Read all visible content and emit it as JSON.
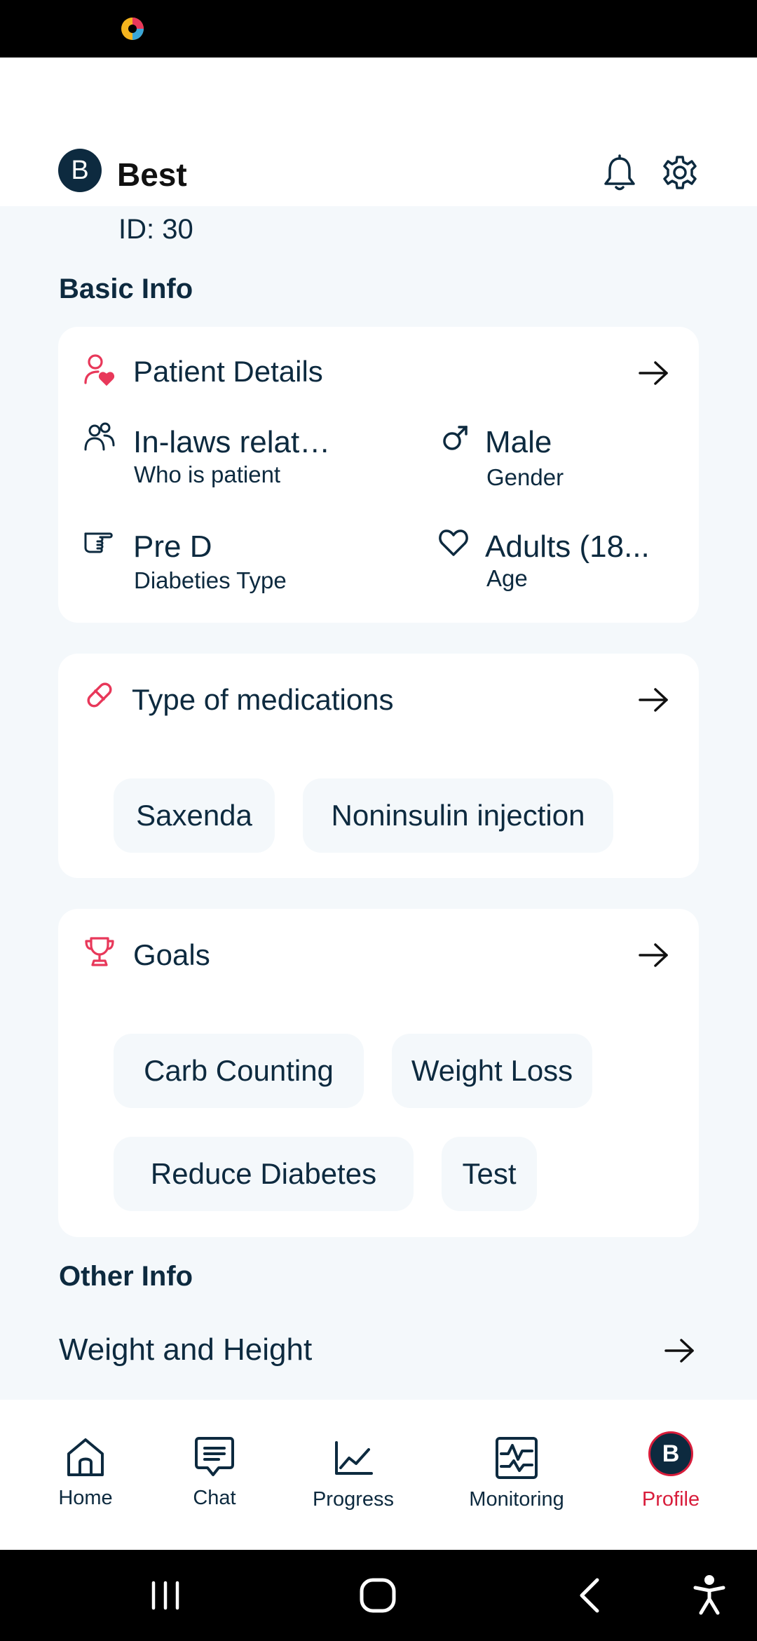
{
  "header": {
    "avatar_letter": "B",
    "user_name": "Best",
    "user_id": "ID: 30"
  },
  "sections": {
    "basic_info": "Basic Info",
    "other_info": "Other Info"
  },
  "patient_details": {
    "title": "Patient Details",
    "fields": [
      {
        "value": "In-laws relatives (d...",
        "label": "Who is patient",
        "icon": "people-icon"
      },
      {
        "value": "Male",
        "label": "Gender",
        "icon": "male-icon"
      },
      {
        "value": "Pre D",
        "label": "Diabeties Type",
        "icon": "pointing-hand-icon"
      },
      {
        "value": "Adults (18...",
        "label": "Age",
        "icon": "heart-icon"
      }
    ]
  },
  "medications": {
    "title": "Type of medications",
    "chips": [
      "Saxenda",
      "Noninsulin injection"
    ]
  },
  "goals": {
    "title": "Goals",
    "chips": [
      "Carb Counting",
      "Weight Loss",
      "Reduce Diabetes",
      "Test"
    ]
  },
  "other_info": {
    "rows": [
      "Weight and Height"
    ]
  },
  "bottom_nav": {
    "items": [
      {
        "label": "Home",
        "icon": "home-icon"
      },
      {
        "label": "Chat",
        "icon": "chat-icon"
      },
      {
        "label": "Progress",
        "icon": "progress-chart-icon"
      },
      {
        "label": "Monitoring",
        "icon": "monitoring-icon"
      },
      {
        "label": "Profile",
        "icon": "profile-avatar"
      }
    ],
    "profile_avatar_letter": "B",
    "active_color": "#d81d3b"
  },
  "colors": {
    "accent": "#e8385a",
    "primary": "#0d2a3f",
    "background": "#f4f8fb"
  }
}
